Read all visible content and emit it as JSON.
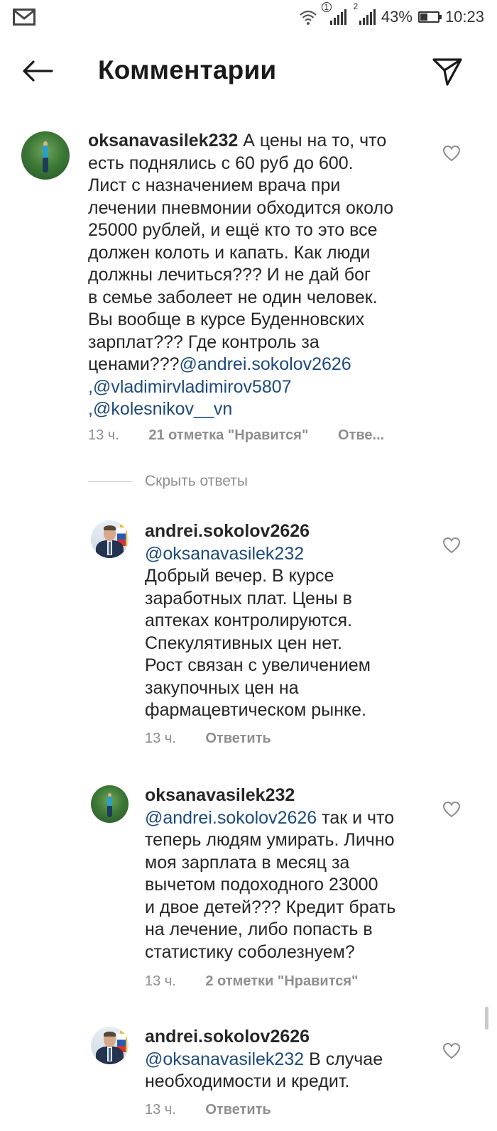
{
  "status_bar": {
    "sim1_label": "1",
    "sim2_label": "2",
    "battery_percent": "43%",
    "battery_level": 0.43,
    "time": "10:23"
  },
  "header": {
    "title": "Комментарии"
  },
  "comments": [
    {
      "username": "oksanavasilek232",
      "lines": [
        "А цены на то, что",
        "есть поднялись с 60 руб до 600.",
        "Лист с назначением врача при",
        "лечении пневмонии обходится около",
        "25000 рублей, и ещё кто то это все",
        "должен колоть и капать. Как люди",
        "должны лечиться??? И не дай бог",
        "в семье заболеет не один человек.",
        "Вы вообще в курсе Буденновских",
        "зарплат??? Где контроль за",
        "ценами???"
      ],
      "mentions": [
        "@andrei.sokolov2626",
        ",@vladimirvladimirov5807",
        ",@kolesnikov__vn"
      ],
      "time": "13 ч.",
      "likes": "21 отметка \"Нравится\"",
      "reply": "Отве..."
    },
    {
      "username": "andrei.sokolov2626",
      "mention": "@oksanavasilek232",
      "lines": [
        "Добрый вечер. В курсе",
        "заработных плат. Цены в",
        "аптеках контролируются.",
        "Спекулятивных цен нет.",
        "Рост связан с увеличением",
        "закупочных цен на",
        "фармацевтическом рынке."
      ],
      "time": "13 ч.",
      "reply": "Ответить"
    },
    {
      "username": "oksanavasilek232",
      "mention": "@andrei.sokolov2626",
      "first_line_rest": "так и что",
      "lines": [
        "теперь людям умирать. Лично",
        "моя зарплата в месяц за",
        "вычетом подоходного 23000",
        "и двое детей??? Кредит брать",
        "на лечение, либо попасть в",
        "статистику соболезнуем?"
      ],
      "time": "13 ч.",
      "likes": "2 отметки \"Нравится\""
    },
    {
      "username": "andrei.sokolov2626",
      "mention": "@oksanavasilek232",
      "first_line_rest": "В случае",
      "lines": [
        "необходимости и кредит."
      ],
      "time": "13 ч.",
      "reply": "Ответить"
    }
  ],
  "hide_replies": "Скрыть ответы",
  "icons": {
    "notification": "mail-icon",
    "wifi": "wifi-icon",
    "signal": "signal-icon",
    "battery": "battery-icon",
    "back": "back-arrow-icon",
    "send": "send-icon",
    "like": "heart-icon"
  }
}
